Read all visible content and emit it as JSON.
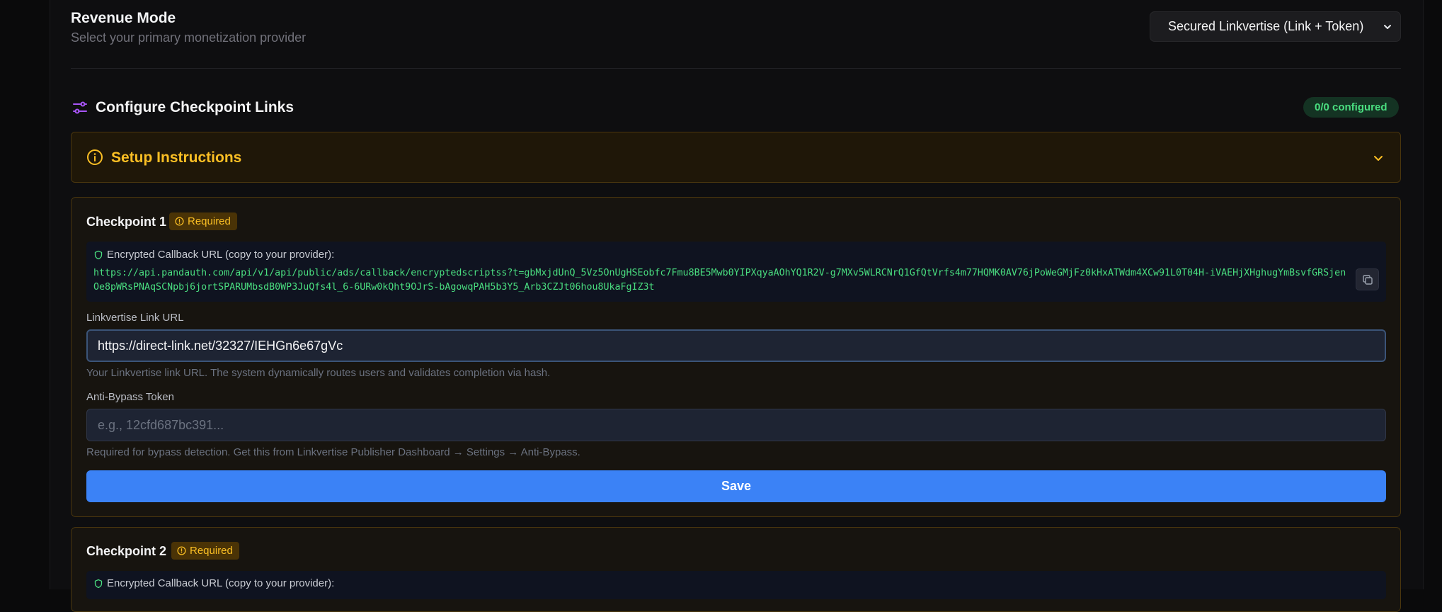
{
  "revenue_mode": {
    "title": "Revenue Mode",
    "subtitle": "Select your primary monetization provider",
    "selected": "Secured Linkvertise (Link + Token)"
  },
  "configure": {
    "title": "Configure Checkpoint Links",
    "badge": "0/0 configured"
  },
  "setup": {
    "title": "Setup Instructions"
  },
  "checkpoints": [
    {
      "title": "Checkpoint 1",
      "badge": "Required",
      "callback_label": "Encrypted Callback URL (copy to your provider):",
      "callback_url": "https://api.pandauth.com/api/v1/api/public/ads/callback/encryptedscriptss?t=gbMxjdUnQ_5Vz5OnUgHSEobfc7Fmu8BE5Mwb0YIPXqyaAOhYQ1R2V-g7MXv5WLRCNrQ1GfQtVrfs4m77HQMK0AV76jPoWeGMjFz0kHxATWdm4XCw91L0T04H-iVAEHjXHghugYmBsvfGRSjenOe8pWRsPNAqSCNpbj6jortSPARUMbsdB0WP3JuQfs4l_6-6URw0kQht9OJrS-bAgowqPAH5b3Y5_Arb3CZJt06hou8UkaFgIZ3t",
      "link_label": "Linkvertise Link URL",
      "link_value": "https://direct-link.net/32327/IEHGn6e67gVc",
      "link_hint": "Your Linkvertise link URL. The system dynamically routes users and validates completion via hash.",
      "token_label": "Anti-Bypass Token",
      "token_placeholder": "e.g., 12cfd687bc391...",
      "token_hint": "Required for bypass detection. Get this from Linkvertise Publisher Dashboard → Settings → Anti-Bypass.",
      "save_label": "Save"
    },
    {
      "title": "Checkpoint 2",
      "badge": "Required",
      "callback_label": "Encrypted Callback URL (copy to your provider):"
    }
  ],
  "colors": {
    "accent": "#3b82f6",
    "success": "#4ade80",
    "warning": "#fbbf24",
    "purple_icon": "#a855f7"
  },
  "icons": {
    "select": "chevron-down-icon",
    "configure": "sliders-icon",
    "setup": "info-icon",
    "expand": "chevron-down-icon",
    "required": "alert-circle-icon",
    "callback": "shield-icon",
    "copy": "copy-icon"
  }
}
